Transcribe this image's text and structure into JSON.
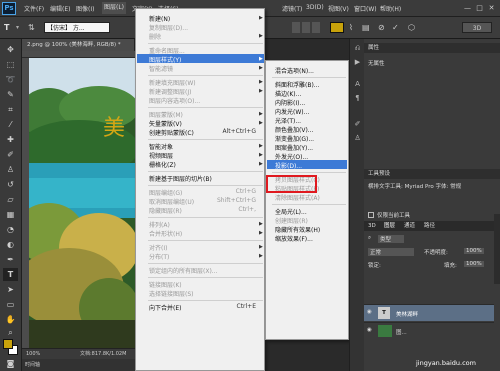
{
  "menubar": {
    "logo": "Ps",
    "items": [
      "文件(F)",
      "编辑(E)",
      "图像(I)",
      "图层(L)",
      "文字(Y)",
      "选择(S)",
      "滤镜(T)",
      "3D(D)",
      "视图(V)",
      "窗口(W)",
      "帮助(H)"
    ],
    "window_controls": [
      "—",
      "□",
      "✕"
    ]
  },
  "options": {
    "font_family": "【仿宋】 方...",
    "right_btn": "3D"
  },
  "document": {
    "tab": "2.png @ 100% (美林海畔, RGB/8) *",
    "zoom": "100%",
    "doc_size": "文档:817.8K/1.02M",
    "timeline": "时间轴",
    "overlay_text": "美"
  },
  "menu_main": [
    {
      "label": "新建(N)",
      "shortcut": "",
      "arrow": true,
      "disabled": false
    },
    {
      "label": "复制图层(D)...",
      "shortcut": "",
      "arrow": false,
      "disabled": true
    },
    {
      "label": "删除",
      "shortcut": "",
      "arrow": true,
      "disabled": true
    },
    {
      "sep": true
    },
    {
      "label": "重命名图层...",
      "shortcut": "",
      "arrow": false,
      "disabled": true
    },
    {
      "label": "图层样式(Y)",
      "shortcut": "",
      "arrow": true,
      "disabled": false,
      "highlight": true
    },
    {
      "label": "智能滤镜",
      "shortcut": "",
      "arrow": true,
      "disabled": true
    },
    {
      "sep": true
    },
    {
      "label": "新建填充图层(W)",
      "shortcut": "",
      "arrow": true,
      "disabled": true
    },
    {
      "label": "新建调整图层(J)",
      "shortcut": "",
      "arrow": true,
      "disabled": true
    },
    {
      "label": "图层内容选项(O)...",
      "shortcut": "",
      "arrow": false,
      "disabled": true
    },
    {
      "sep": true
    },
    {
      "label": "图层蒙版(M)",
      "shortcut": "",
      "arrow": true,
      "disabled": true
    },
    {
      "label": "矢量蒙版(V)",
      "shortcut": "",
      "arrow": true,
      "disabled": false
    },
    {
      "label": "创建剪贴蒙版(C)",
      "shortcut": "Alt+Ctrl+G",
      "arrow": false,
      "disabled": false
    },
    {
      "sep": true
    },
    {
      "label": "智能对象",
      "shortcut": "",
      "arrow": true,
      "disabled": false
    },
    {
      "label": "视频图层",
      "shortcut": "",
      "arrow": true,
      "disabled": false
    },
    {
      "label": "栅格化(Z)",
      "shortcut": "",
      "arrow": true,
      "disabled": false
    },
    {
      "sep": true
    },
    {
      "label": "新建基于图层的切片(B)",
      "shortcut": "",
      "arrow": false,
      "disabled": false
    },
    {
      "sep": true
    },
    {
      "label": "图层编组(G)",
      "shortcut": "Ctrl+G",
      "arrow": false,
      "disabled": true
    },
    {
      "label": "取消图层编组(U)",
      "shortcut": "Shift+Ctrl+G",
      "arrow": false,
      "disabled": true
    },
    {
      "label": "隐藏图层(R)",
      "shortcut": "Ctrl+,",
      "arrow": false,
      "disabled": true
    },
    {
      "sep": true
    },
    {
      "label": "排列(A)",
      "shortcut": "",
      "arrow": true,
      "disabled": true
    },
    {
      "label": "合并形状(H)",
      "shortcut": "",
      "arrow": true,
      "disabled": true
    },
    {
      "sep": true
    },
    {
      "label": "对齐(I)",
      "shortcut": "",
      "arrow": true,
      "disabled": true
    },
    {
      "label": "分布(T)",
      "shortcut": "",
      "arrow": true,
      "disabled": true
    },
    {
      "sep": true
    },
    {
      "label": "锁定组内的所有图层(X)...",
      "shortcut": "",
      "arrow": false,
      "disabled": true
    },
    {
      "sep": true
    },
    {
      "label": "链接图层(K)",
      "shortcut": "",
      "arrow": false,
      "disabled": true
    },
    {
      "label": "选择链接图层(S)",
      "shortcut": "",
      "arrow": false,
      "disabled": true
    },
    {
      "sep": true
    },
    {
      "label": "向下合并(E)",
      "shortcut": "Ctrl+E",
      "arrow": false,
      "disabled": false
    }
  ],
  "menu_sub": [
    {
      "label": "混合选项(N)...",
      "disabled": false
    },
    {
      "sep": true
    },
    {
      "label": "斜面和浮雕(B)...",
      "disabled": false
    },
    {
      "label": "描边(K)...",
      "disabled": false
    },
    {
      "label": "内阴影(I)...",
      "disabled": false
    },
    {
      "label": "内发光(W)...",
      "disabled": false
    },
    {
      "label": "光泽(T)...",
      "disabled": false
    },
    {
      "label": "颜色叠加(V)...",
      "disabled": false
    },
    {
      "label": "渐变叠加(G)...",
      "disabled": false
    },
    {
      "label": "图案叠加(Y)...",
      "disabled": false
    },
    {
      "label": "外发光(O)...",
      "disabled": false
    },
    {
      "label": "投影(D)...",
      "disabled": false,
      "highlight": true
    },
    {
      "sep": true
    },
    {
      "label": "拷贝图层样式(C)",
      "disabled": true
    },
    {
      "label": "粘贴图层样式(P)",
      "disabled": true
    },
    {
      "label": "清除图层样式(A)",
      "disabled": true
    },
    {
      "sep": true
    },
    {
      "label": "全局光(L)...",
      "disabled": false
    },
    {
      "label": "创建图层(R)",
      "disabled": true
    },
    {
      "label": "隐藏所有效果(H)",
      "disabled": false
    },
    {
      "label": "缩放效果(F)...",
      "disabled": false
    }
  ],
  "panels": {
    "properties_header": "属性",
    "properties_body": "无属性",
    "tool_preset_header": "工具预设",
    "tool_preset_item": "横排文字工具: Myriad Pro 字体: 常规",
    "tool_preset_check": "仅限当前工具",
    "layers_tabs": [
      "3D",
      "图层",
      "通道",
      "路径"
    ],
    "filter_label": "类型",
    "blend_mode": "正常",
    "opacity_label": "不透明度:",
    "opacity_value": "100%",
    "lock_label": "锁定:",
    "fill_label": "填充:",
    "fill_value": "100%",
    "layer1": "美林湖畔",
    "layer2": "图..."
  },
  "watermark": "jingyan.baidu.com",
  "colors": {
    "accent": "#3d7ad6",
    "red_box": "#e0191f"
  }
}
